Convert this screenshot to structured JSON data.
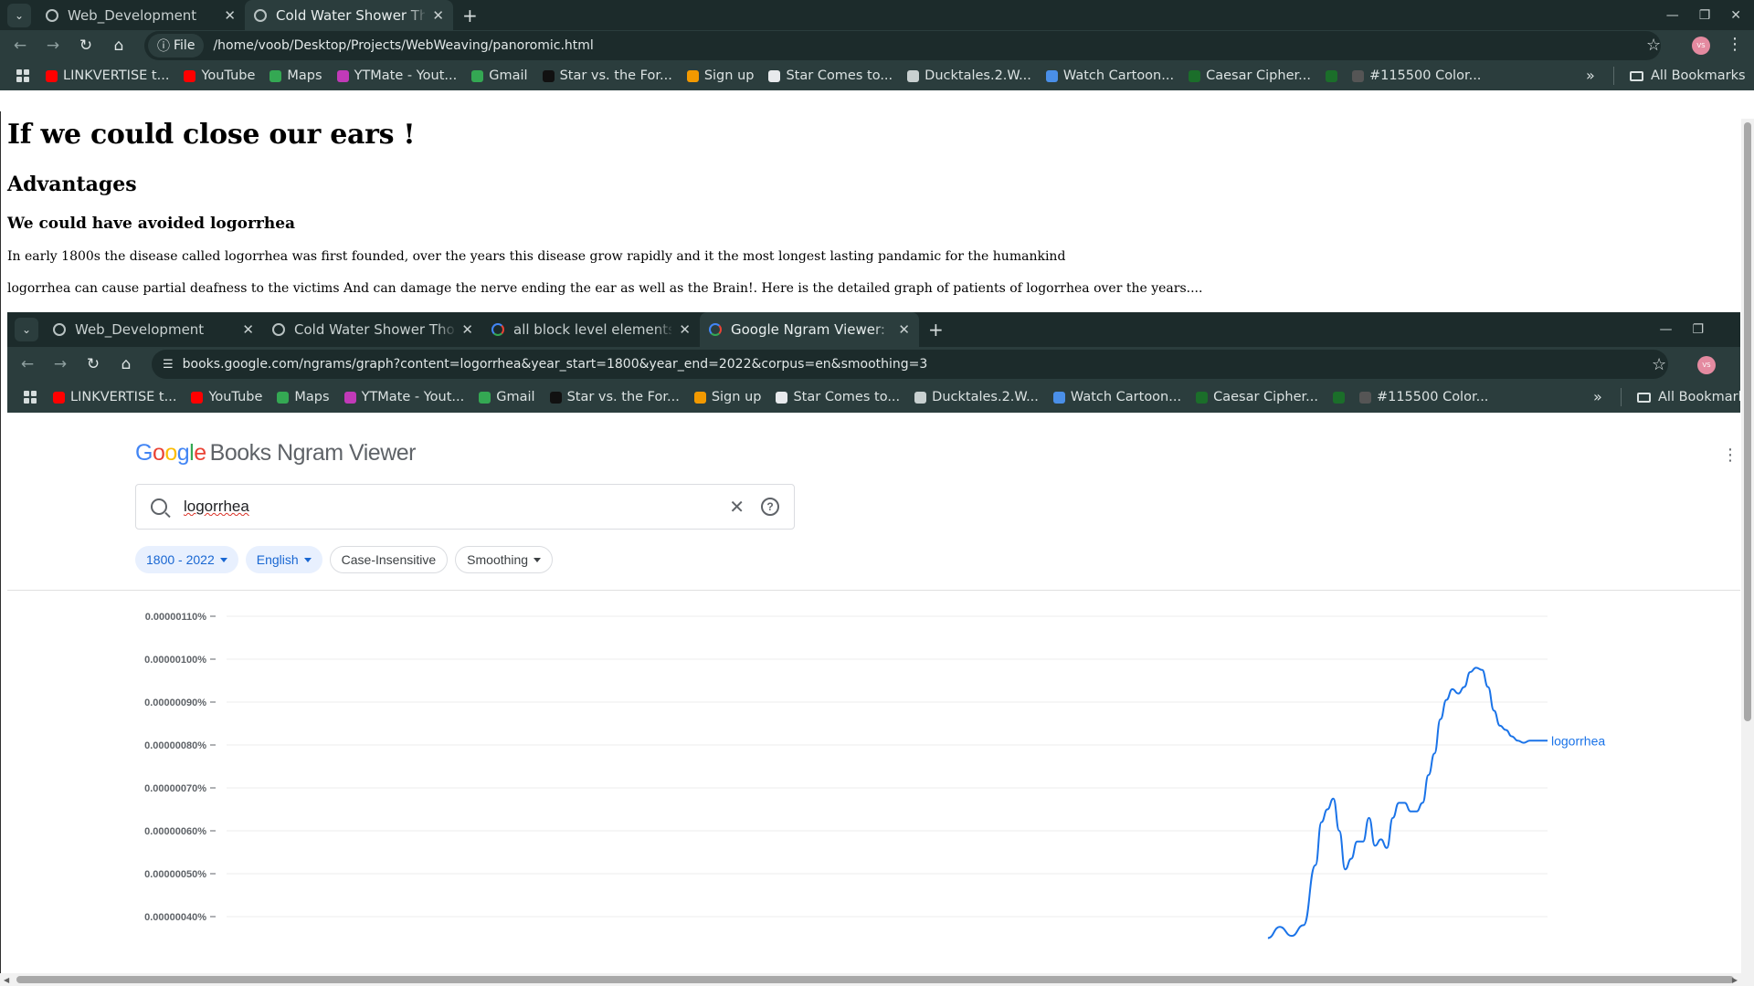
{
  "outer_browser": {
    "tabs": [
      {
        "title": "Web_Development"
      },
      {
        "title": "Cold Water Shower Thou"
      }
    ],
    "address": {
      "scheme_label": "File",
      "url": "/home/voob/Desktop/Projects/WebWeaving/panoromic.html"
    },
    "avatar_initials": "VS",
    "bookmarks": [
      {
        "label": "LINKVERTISE t...",
        "color": "#ff0000"
      },
      {
        "label": "YouTube",
        "color": "#ff0000"
      },
      {
        "label": "Maps",
        "color": "#34a853"
      },
      {
        "label": "YTMate - Yout...",
        "color": "#c13ab8"
      },
      {
        "label": "Gmail",
        "color": "#34a853"
      },
      {
        "label": "Star vs. the For...",
        "color": "#111111"
      },
      {
        "label": "Sign up",
        "color": "#f29900"
      },
      {
        "label": "Star Comes to...",
        "color": "#e8eaed"
      },
      {
        "label": "Ducktales.2.W...",
        "color": "#c8d0d0"
      },
      {
        "label": "Watch Cartoon...",
        "color": "#4a8fe8"
      },
      {
        "label": "Caesar Cipher...",
        "color": "#1b6e2a"
      },
      {
        "label": "",
        "color": "#1b6e2a"
      },
      {
        "label": "#115500 Color...",
        "color": "#555555"
      }
    ],
    "all_bookmarks": "All Bookmarks"
  },
  "page": {
    "h1": "If we could close our ears !",
    "h2": "Advantages",
    "h3": "We could have avoided logorrhea",
    "p1": "In early 1800s the disease called logorrhea was first founded, over the years this disease grow rapidly and it the most longest lasting pandamic for the humankind",
    "p2": "logorrhea can cause partial deafness to the victims And can damage the nerve ending the ear as well as the Brain!. Here is the detailed graph of patients of logorrhea over the years...."
  },
  "embedded_browser": {
    "tabs": [
      {
        "title": "Web_Development"
      },
      {
        "title": "Cold Water Shower Thou"
      },
      {
        "title": "all block level elements i"
      },
      {
        "title": "Google Ngram Viewer: lo"
      }
    ],
    "url": "books.google.com/ngrams/graph?content=logorrhea&year_start=1800&year_end=2022&corpus=en&smoothing=3",
    "all_bookmarks": "All Bookmark"
  },
  "ngram": {
    "logo": {
      "g1": "G",
      "o1": "o",
      "o2": "o",
      "g2": "g",
      "l": "l",
      "e": "e",
      "rest": "Books Ngram Viewer"
    },
    "query": "logorrhea",
    "filters": {
      "years": "1800 - 2022",
      "language": "English",
      "case": "Case-Insensitive",
      "smoothing": "Smoothing"
    }
  },
  "chart_data": {
    "type": "line",
    "title": "",
    "xlabel": "",
    "ylabel": "",
    "y_ticks": [
      "0.00000110%",
      "0.00000100%",
      "0.00000090%",
      "0.00000080%",
      "0.00000070%",
      "0.00000060%",
      "0.00000050%",
      "0.00000040%"
    ],
    "y_tick_values": [
      1.1e-06,
      1e-06,
      9e-07,
      8e-07,
      7e-07,
      6e-07,
      5e-07,
      4e-07
    ],
    "x_range": [
      1800,
      2022
    ],
    "ylim_visible": [
      3.5e-07,
      1.13e-06
    ],
    "series": [
      {
        "name": "logorrhea",
        "color": "#1a73e8",
        "x": [
          1975,
          1977,
          1979,
          1981,
          1983,
          1984,
          1985,
          1986,
          1987,
          1988,
          1989,
          1990,
          1991,
          1992,
          1993,
          1994,
          1995,
          1996,
          1997,
          1998,
          1999,
          2000,
          2001,
          2002,
          2003,
          2004,
          2005,
          2006,
          2007,
          2008,
          2009,
          2010,
          2011,
          2012,
          2013,
          2014,
          2015,
          2016,
          2017,
          2018,
          2019,
          2020,
          2021,
          2022
        ],
        "values": [
          3.5e-07,
          3.76e-07,
          3.55e-07,
          3.8e-07,
          5.2e-07,
          6.2e-07,
          6.5e-07,
          6.75e-07,
          6e-07,
          5.1e-07,
          5.35e-07,
          5.75e-07,
          5.75e-07,
          6.3e-07,
          5.65e-07,
          5.8e-07,
          5.6e-07,
          6.3e-07,
          6.65e-07,
          6.65e-07,
          6.45e-07,
          6.45e-07,
          6.65e-07,
          7.3e-07,
          7.8e-07,
          8.6e-07,
          9.05e-07,
          9.3e-07,
          9.2e-07,
          9.35e-07,
          9.7e-07,
          9.8e-07,
          9.75e-07,
          9.35e-07,
          8.8e-07,
          8.45e-07,
          8.35e-07,
          8.2e-07,
          8.1e-07,
          8.05e-07,
          8.1e-07,
          8.1e-07,
          8.1e-07,
          8.1e-07
        ]
      }
    ]
  }
}
